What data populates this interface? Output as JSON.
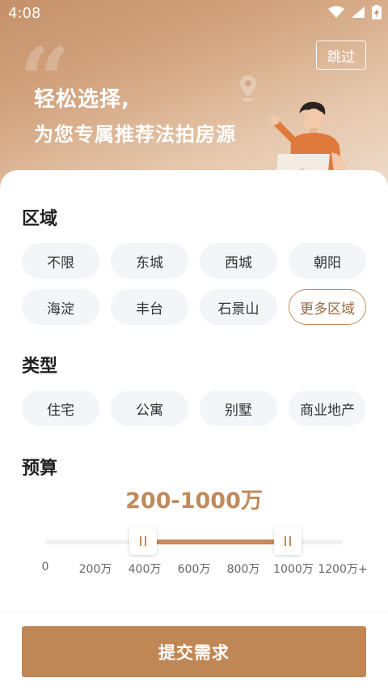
{
  "status_bar": {
    "time": "4:08",
    "icons": [
      "wifi-icon",
      "signal-icon",
      "battery-charging-icon"
    ]
  },
  "hero": {
    "line1": "轻松选择,",
    "line2": "为您专属推荐法拍房源",
    "skip_label": "跳过"
  },
  "region": {
    "title": "区域",
    "options": [
      "不限",
      "东城",
      "西城",
      "朝阳",
      "海淀",
      "丰台",
      "石景山",
      "更多区域"
    ]
  },
  "type": {
    "title": "类型",
    "options": [
      "住宅",
      "公寓",
      "别墅",
      "商业地产"
    ]
  },
  "budget": {
    "title": "预算",
    "value_text": "200-1000万",
    "range": [
      0,
      1200
    ],
    "selected_min": 200,
    "selected_max": 1000,
    "ticks": [
      "0",
      "200万",
      "400万",
      "600万",
      "800万",
      "1000万",
      "1200万+"
    ]
  },
  "submit_label": "提交需求",
  "colors": {
    "accent": "#c08756",
    "accent_text": "#c08a5c",
    "chip_bg": "#f4f5f9",
    "hero_start": "#c49069",
    "hero_end": "#efddcc"
  }
}
